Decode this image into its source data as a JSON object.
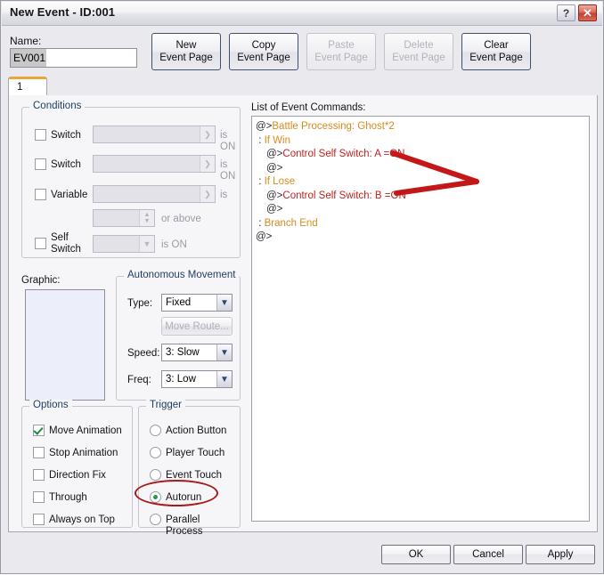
{
  "window": {
    "title": "New Event - ID:001",
    "help_button": "?",
    "close_button": "✕"
  },
  "toolbar": {
    "name_label": "Name:",
    "name_value": "EV001",
    "name_placeholder": "",
    "buttons": [
      {
        "line1": "New",
        "line2": "Event Page",
        "enabled": true
      },
      {
        "line1": "Copy",
        "line2": "Event Page",
        "enabled": true
      },
      {
        "line1": "Paste",
        "line2": "Event Page",
        "enabled": false
      },
      {
        "line1": "Delete",
        "line2": "Event Page",
        "enabled": false
      },
      {
        "line1": "Clear",
        "line2": "Event Page",
        "enabled": true
      }
    ]
  },
  "tabs": [
    {
      "label": "1",
      "selected": true
    }
  ],
  "conditions": {
    "group_label": "Conditions",
    "rows": [
      {
        "checkbox_label": "Switch",
        "checked": false,
        "value": "",
        "suffix": "is ON"
      },
      {
        "checkbox_label": "Switch",
        "checked": false,
        "value": "",
        "suffix": "is ON"
      },
      {
        "checkbox_label": "Variable",
        "checked": false,
        "value": "",
        "suffix": "is"
      },
      {
        "checkbox_label": "",
        "checked": null,
        "value": "",
        "suffix": "or above"
      },
      {
        "checkbox_label": "Self Switch",
        "checked": false,
        "value": "",
        "suffix": "is ON"
      }
    ],
    "self_switch_label_line1": "Self",
    "self_switch_label_line2": "Switch"
  },
  "graphic": {
    "label": "Graphic:",
    "image": ""
  },
  "autonomous_movement": {
    "group_label": "Autonomous Movement",
    "type_label": "Type:",
    "type_value": "Fixed",
    "move_route_button": "Move Route...",
    "move_route_enabled": false,
    "speed_label": "Speed:",
    "speed_value": "3: Slow",
    "freq_label": "Freq:",
    "freq_value": "3: Low"
  },
  "options": {
    "group_label": "Options",
    "items": [
      {
        "label": "Move Animation",
        "checked": true
      },
      {
        "label": "Stop Animation",
        "checked": false
      },
      {
        "label": "Direction Fix",
        "checked": false
      },
      {
        "label": "Through",
        "checked": false
      },
      {
        "label": "Always on Top",
        "checked": false
      }
    ]
  },
  "trigger": {
    "group_label": "Trigger",
    "items": [
      {
        "label": "Action Button",
        "selected": false
      },
      {
        "label": "Player Touch",
        "selected": false
      },
      {
        "label": "Event Touch",
        "selected": false
      },
      {
        "label": "Autorun",
        "selected": true
      },
      {
        "label": "Parallel Process",
        "selected": false
      }
    ]
  },
  "commands": {
    "title": "List of Event Commands:",
    "lines": [
      {
        "prefix": "@>",
        "text": "Battle Processing: Ghost*2",
        "indent": 0,
        "color": "gold"
      },
      {
        "prefix": " : ",
        "text": "If Win",
        "indent": 0,
        "color": "gold"
      },
      {
        "prefix": "@>",
        "text": "Control Self Switch: A =ON",
        "indent": 1,
        "color": "red"
      },
      {
        "prefix": "@>",
        "text": "",
        "indent": 1,
        "color": "gold"
      },
      {
        "prefix": " : ",
        "text": "If Lose",
        "indent": 0,
        "color": "gold"
      },
      {
        "prefix": "@>",
        "text": "Control Self Switch: B =ON",
        "indent": 1,
        "color": "red"
      },
      {
        "prefix": "@>",
        "text": "",
        "indent": 1,
        "color": "gold"
      },
      {
        "prefix": " : ",
        "text": "Branch End",
        "indent": 0,
        "color": "gold"
      },
      {
        "prefix": "@>",
        "text": "",
        "indent": 0,
        "color": "gold"
      }
    ]
  },
  "footer": {
    "ok": "OK",
    "cancel": "Cancel",
    "apply": "Apply"
  },
  "annotations": {
    "arrow_color": "#c41818",
    "ellipse_color": "#a81818",
    "arrow_description": "double-arrow pointing right at the two Control Self Switch lines",
    "ellipse_description": "red oval around the Autorun trigger radio"
  }
}
